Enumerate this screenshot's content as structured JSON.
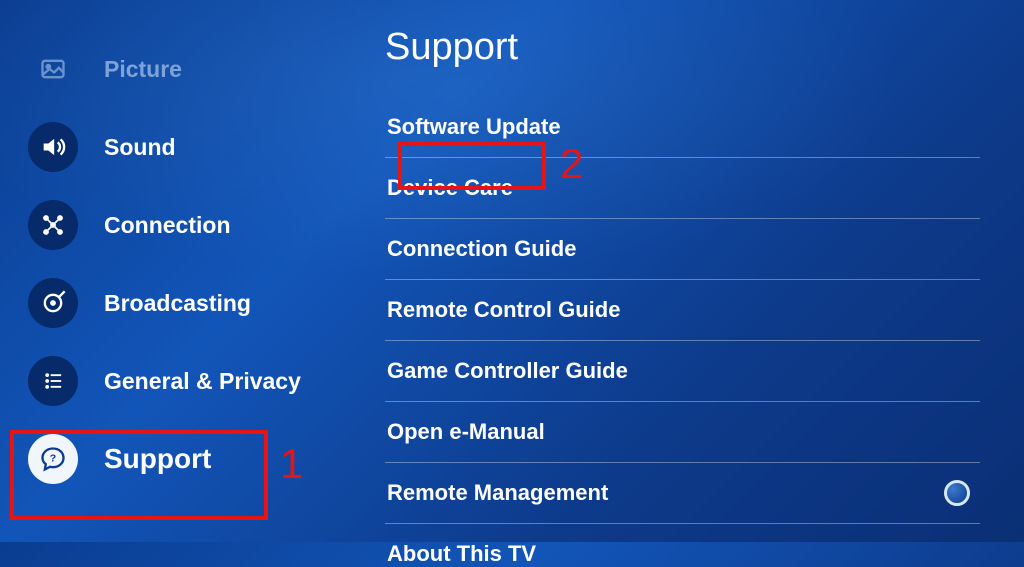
{
  "sidebar": {
    "items": [
      {
        "label": "Picture",
        "icon": "picture-icon",
        "state": "inactive"
      },
      {
        "label": "Sound",
        "icon": "sound-icon",
        "state": "active"
      },
      {
        "label": "Connection",
        "icon": "connection-icon",
        "state": "active"
      },
      {
        "label": "Broadcasting",
        "icon": "broadcasting-icon",
        "state": "active"
      },
      {
        "label": "General & Privacy",
        "icon": "general-privacy-icon",
        "state": "active"
      },
      {
        "label": "Support",
        "icon": "support-icon",
        "state": "selected"
      }
    ]
  },
  "main": {
    "title": "Support",
    "items": [
      {
        "label": "Software Update"
      },
      {
        "label": "Device Care"
      },
      {
        "label": "Connection Guide"
      },
      {
        "label": "Remote Control Guide"
      },
      {
        "label": "Game Controller Guide"
      },
      {
        "label": "Open e-Manual"
      },
      {
        "label": "Remote Management",
        "radio": true
      },
      {
        "label": "About This TV"
      }
    ]
  },
  "annotations": {
    "marker1": "1",
    "marker2": "2"
  }
}
